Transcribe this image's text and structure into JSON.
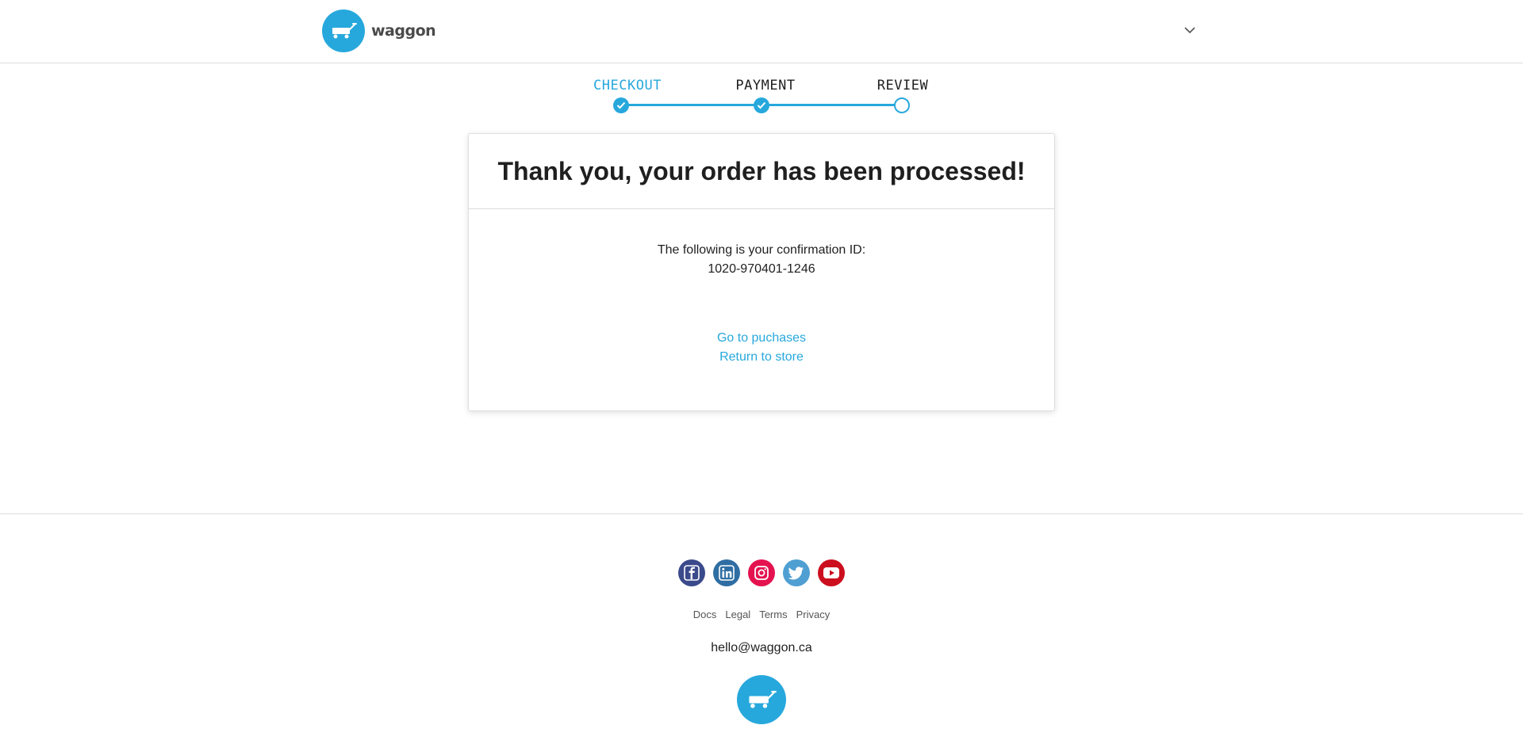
{
  "header": {
    "brand": "waggon",
    "logo_icon": "wagon-icon",
    "account_menu_icon": "chevron-down-icon"
  },
  "stepper": {
    "steps": [
      {
        "label": "CHECKOUT",
        "state": "complete",
        "active": true
      },
      {
        "label": "PAYMENT",
        "state": "complete",
        "active": false
      },
      {
        "label": "REVIEW",
        "state": "current",
        "active": false
      }
    ]
  },
  "card": {
    "title": "Thank you, your order has been processed!",
    "confirmation_text": "The following is your confirmation ID:",
    "confirmation_id": "1020-970401-1246",
    "links": {
      "purchases": "Go to puchases",
      "store": "Return to store"
    }
  },
  "footer": {
    "social": [
      {
        "name": "facebook-icon",
        "color": "#3b4a8b"
      },
      {
        "name": "linkedin-icon",
        "color": "#2f6ea3"
      },
      {
        "name": "instagram-icon",
        "color": "#e4134f"
      },
      {
        "name": "twitter-icon",
        "color": "#4f9fd3"
      },
      {
        "name": "youtube-icon",
        "color": "#cc0f1f"
      }
    ],
    "links": [
      "Docs",
      "Legal",
      "Terms",
      "Privacy"
    ],
    "email": "hello@waggon.ca"
  },
  "colors": {
    "accent": "#27a8dc",
    "text": "#1f1f1f",
    "border": "#dcdcdc"
  }
}
